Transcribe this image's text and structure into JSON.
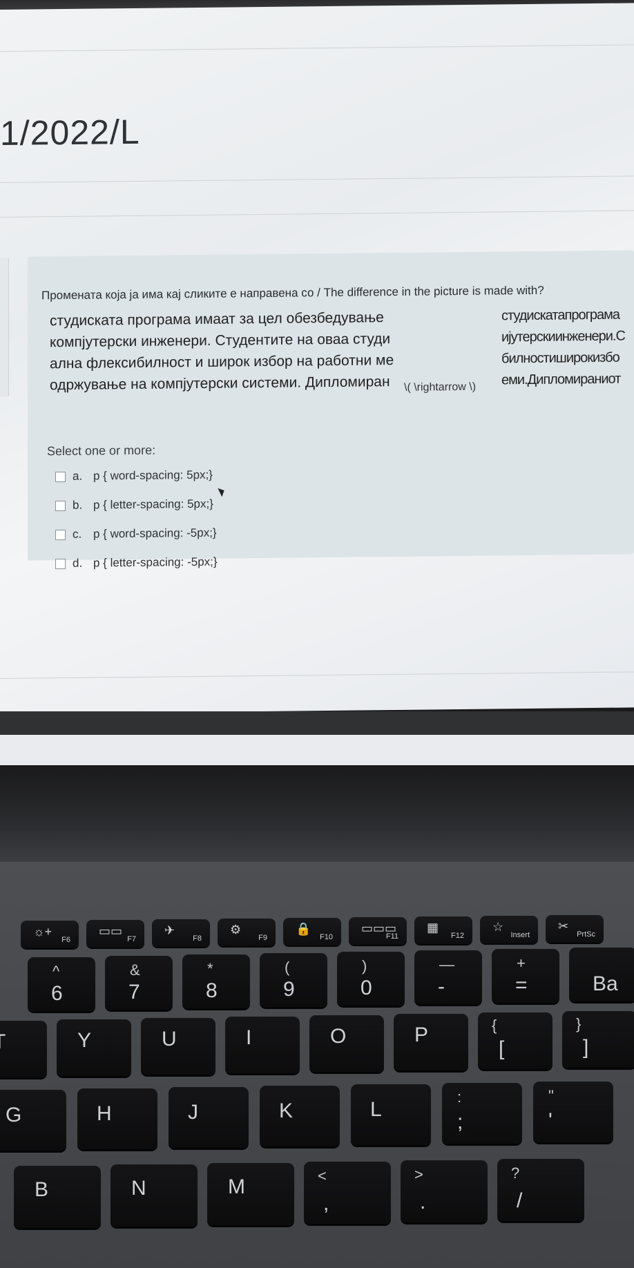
{
  "page": {
    "course_code": "1/2022/L"
  },
  "question": {
    "prompt": "Промената која ја има кај сликите е направена со / The difference in the picture is made with?",
    "sample_left_lines": [
      "студиската програма имаат за цел обезбедување",
      "компјутерски инженери. Студентите на оваа студи",
      "ална флексибилност и широк избор на работни ме",
      "одржување на компјутерски системи. Дипломиран"
    ],
    "arrow_text": "\\( \\rightarrow \\)",
    "sample_right_lines": [
      "студискатапрограма",
      "ијутерскиинженери.С",
      "билностиширокизбо",
      "еми.Дипломираниот"
    ],
    "select_label": "Select one or more:",
    "options": [
      {
        "letter": "a.",
        "text": "p { word-spacing: 5px;}"
      },
      {
        "letter": "b.",
        "text": "p { letter-spacing: 5px;}"
      },
      {
        "letter": "c.",
        "text": "p { word-spacing: -5px;}"
      },
      {
        "letter": "d.",
        "text": "p { letter-spacing: -5px;}"
      }
    ]
  },
  "keyboard": {
    "function_keys": [
      {
        "label": "F6",
        "icon": "☼+"
      },
      {
        "label": "F7",
        "icon": "▭▭"
      },
      {
        "label": "F8",
        "icon": "✈"
      },
      {
        "label": "F9",
        "icon": "⚙"
      },
      {
        "label": "F10",
        "icon": "🔒"
      },
      {
        "label": "F11",
        "icon": "▭▭▭"
      },
      {
        "label": "F12",
        "icon": "▦"
      },
      {
        "label": "Insert",
        "icon": "☆"
      },
      {
        "label": "PrtSc",
        "icon": "✂"
      }
    ],
    "number_row": [
      {
        "main": "6",
        "top": "^"
      },
      {
        "main": "7",
        "top": "&"
      },
      {
        "main": "8",
        "top": "*"
      },
      {
        "main": "9",
        "top": "("
      },
      {
        "main": "0",
        "top": ")"
      },
      {
        "main": "-",
        "top": "—"
      },
      {
        "main": "=",
        "top": "+"
      },
      {
        "main": "Ba",
        "top": ""
      }
    ],
    "top_row": [
      "T",
      "Y",
      "U",
      "I",
      "O",
      "P",
      "[",
      "]"
    ],
    "top_row_shift": [
      "",
      "",
      "",
      "",
      "",
      "",
      "{",
      "}"
    ],
    "home_row": [
      "G",
      "H",
      "J",
      "K",
      "L",
      ";",
      "'"
    ],
    "home_row_shift": [
      "",
      "",
      "",
      "",
      "",
      ":",
      "\""
    ],
    "bottom_row": [
      "B",
      "N",
      "M",
      ",",
      ".",
      "/"
    ],
    "bottom_row_shift": [
      "",
      "",
      "",
      "<",
      ">",
      "?"
    ]
  }
}
